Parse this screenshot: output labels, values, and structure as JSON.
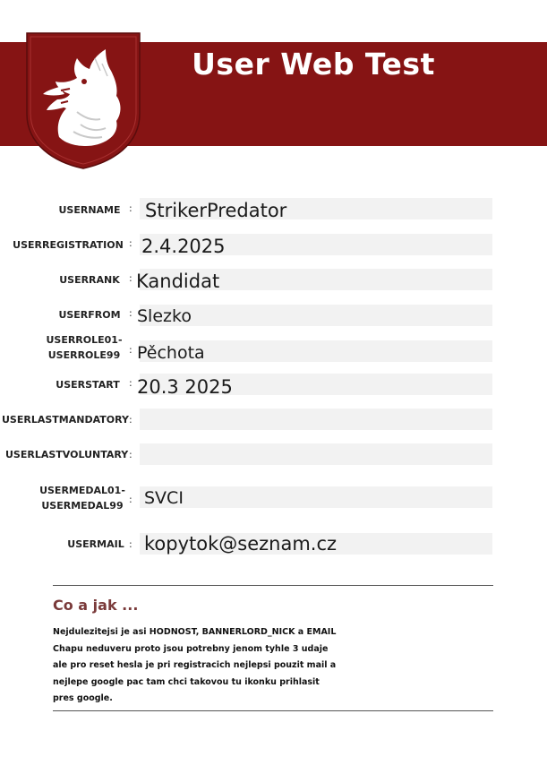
{
  "header": {
    "title": "User Web Test",
    "crest_icon": "wolf-head-crest-icon",
    "banner_color": "#861414"
  },
  "fields": {
    "username": {
      "label": "USERNAME",
      "value": "StrikerPredator"
    },
    "userregistration": {
      "label": "USERREGISTRATION",
      "value": "2.4.2025"
    },
    "userrank": {
      "label": "USERRANK",
      "value": "Kandidat"
    },
    "userfrom": {
      "label": "USERFROM",
      "value": "Slezko"
    },
    "userrole": {
      "label_line1": "USERROLE01-",
      "label_line2": "USERROLE99",
      "value": "Pěchota"
    },
    "userstart": {
      "label": "USERSTART",
      "value": "20.3 2025"
    },
    "userlastmandatory": {
      "label": "USERLASTMANDATORY",
      "value": ""
    },
    "userlastvoluntary": {
      "label": "USERLASTVOLUNTARY",
      "value": ""
    },
    "usermedal": {
      "label_line1": "USERMEDAL01-",
      "label_line2": "USERMEDAL99",
      "value": "SVCI"
    },
    "usermail": {
      "label": "USERMAIL",
      "value": "kopytok@seznam.cz"
    }
  },
  "colon": ":",
  "note": {
    "title": "Co a jak ...",
    "lines": [
      "Nejdulezitejsi je asi HODNOST, BANNERLORD_NICK a EMAIL",
      "Chapu neduveru proto jsou potrebny jenom tyhle 3 udaje",
      "ale pro reset hesla je pri registracich nejlepsi pouzit mail a",
      "nejlepe google pac tam chci takovou tu ikonku prihlasit",
      "pres google."
    ]
  }
}
